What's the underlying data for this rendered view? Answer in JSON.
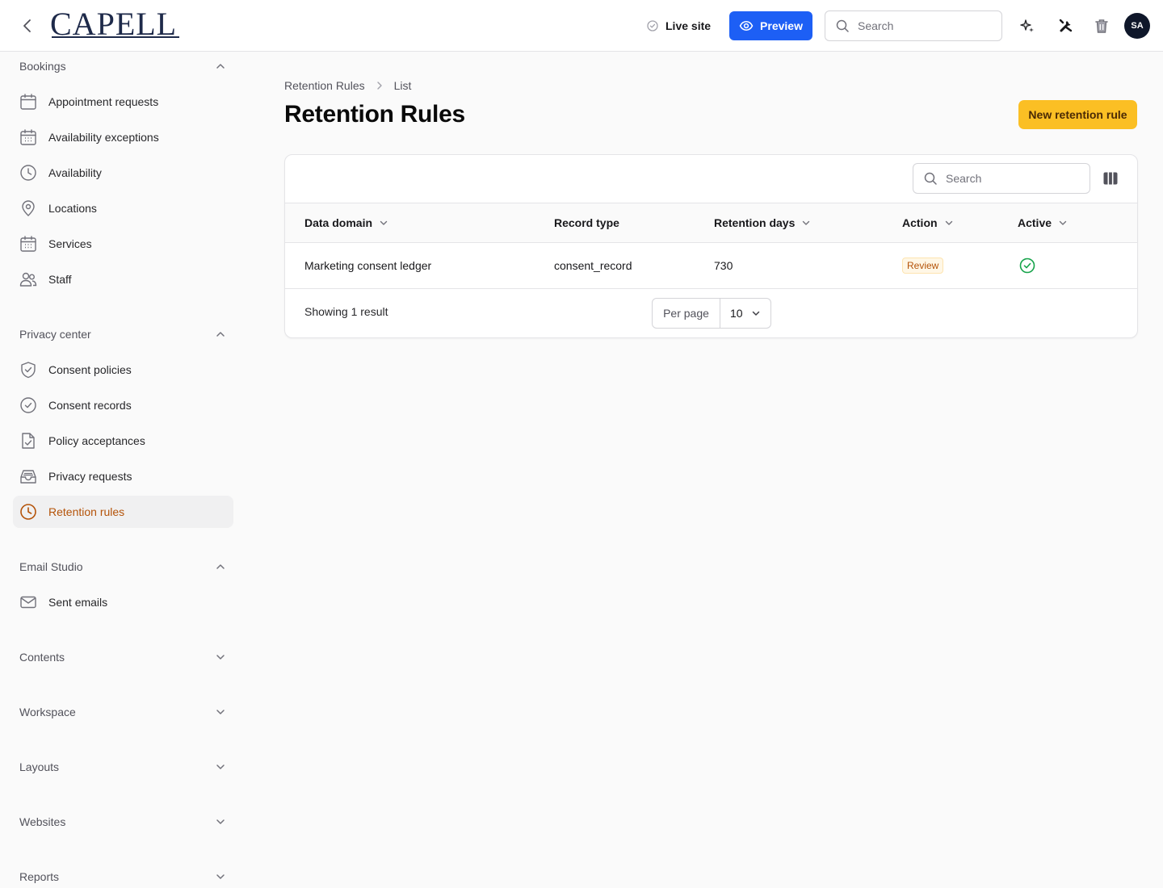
{
  "header": {
    "logo_text": "CAPELL",
    "live_site_label": "Live site",
    "preview_label": "Preview",
    "search_placeholder": "Search",
    "avatar_initials": "SA",
    "accent_color": "#1d5ff5"
  },
  "sidebar": {
    "groups": [
      {
        "label": "Bookings",
        "expanded": true,
        "items": [
          {
            "label": "Appointment requests",
            "icon": "calendar-icon"
          },
          {
            "label": "Availability exceptions",
            "icon": "calendar-days-icon"
          },
          {
            "label": "Availability",
            "icon": "clock-icon"
          },
          {
            "label": "Locations",
            "icon": "map-pin-icon"
          },
          {
            "label": "Services",
            "icon": "calendar-days-icon"
          },
          {
            "label": "Staff",
            "icon": "users-icon"
          }
        ]
      },
      {
        "label": "Privacy center",
        "expanded": true,
        "items": [
          {
            "label": "Consent policies",
            "icon": "shield-check-icon"
          },
          {
            "label": "Consent records",
            "icon": "check-circle-icon"
          },
          {
            "label": "Policy acceptances",
            "icon": "document-check-icon"
          },
          {
            "label": "Privacy requests",
            "icon": "inbox-icon"
          },
          {
            "label": "Retention rules",
            "icon": "clock-icon",
            "active": true
          }
        ]
      },
      {
        "label": "Email Studio",
        "expanded": true,
        "items": [
          {
            "label": "Sent emails",
            "icon": "envelope-icon"
          }
        ]
      },
      {
        "label": "Contents",
        "expanded": false,
        "items": []
      },
      {
        "label": "Workspace",
        "expanded": false,
        "items": []
      },
      {
        "label": "Layouts",
        "expanded": false,
        "items": []
      },
      {
        "label": "Websites",
        "expanded": false,
        "items": []
      },
      {
        "label": "Reports",
        "expanded": false,
        "items": []
      }
    ],
    "active_color": "#b45309"
  },
  "main": {
    "breadcrumb": [
      "Retention Rules",
      "List"
    ],
    "title": "Retention Rules",
    "new_button_label": "New retention rule",
    "table": {
      "search_placeholder": "Search",
      "columns": [
        {
          "label": "Data domain",
          "sortable": true
        },
        {
          "label": "Record type",
          "sortable": false
        },
        {
          "label": "Retention days",
          "sortable": true
        },
        {
          "label": "Action",
          "sortable": true
        },
        {
          "label": "Active",
          "sortable": true
        }
      ],
      "rows": [
        {
          "data_domain": "Marketing consent ledger",
          "record_type": "consent_record",
          "retention_days": "730",
          "action": "Review",
          "active": true
        }
      ],
      "footer": {
        "result_text": "Showing 1 result",
        "per_page_label": "Per page",
        "per_page_value": "10"
      }
    }
  }
}
